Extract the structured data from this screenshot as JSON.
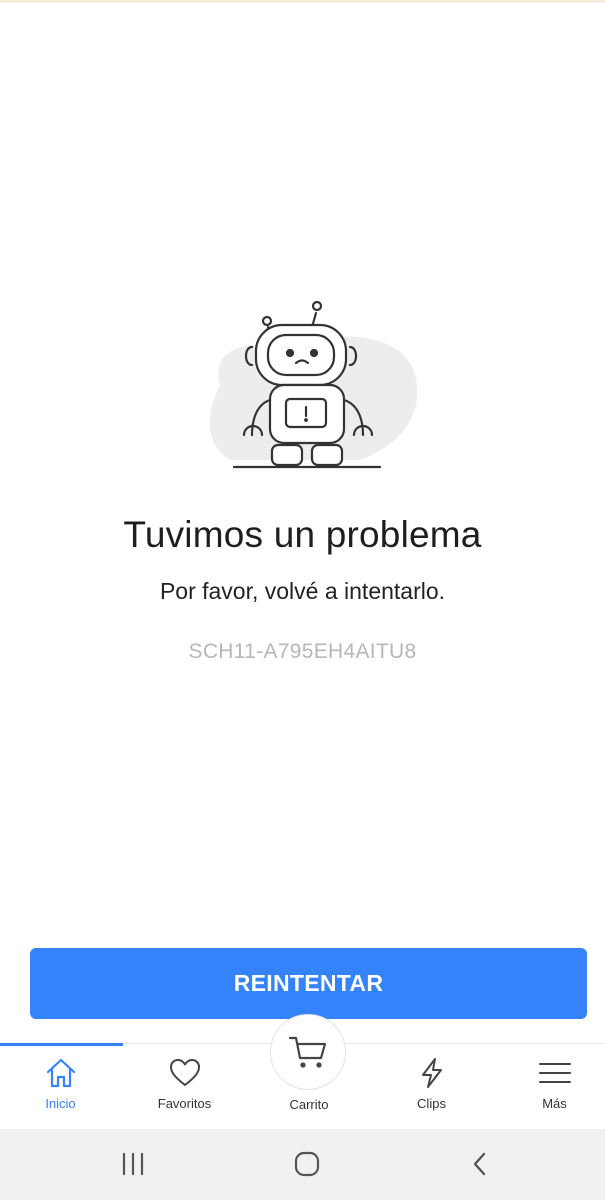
{
  "error": {
    "title": "Tuvimos un problema",
    "subtitle": "Por favor, volvé a intentarlo.",
    "code": "SCH11-A795EH4AITU8",
    "illustration_icon": "sad-robot-icon"
  },
  "actions": {
    "retry_label": "REINTENTAR"
  },
  "tabbar": {
    "tabs": [
      {
        "label": "Inicio",
        "icon": "home-icon",
        "active": true
      },
      {
        "label": "Favoritos",
        "icon": "heart-icon",
        "active": false
      },
      {
        "label": "Carrito",
        "icon": "cart-icon",
        "active": false
      },
      {
        "label": "Clips",
        "icon": "lightning-icon",
        "active": false
      },
      {
        "label": "Más",
        "icon": "menu-icon",
        "active": false
      }
    ]
  },
  "system_nav": {
    "buttons": [
      "recent-apps-icon",
      "home-circle-icon",
      "back-icon"
    ]
  },
  "colors": {
    "accent": "#3483fa",
    "code_text": "#b7b7b7",
    "nav_bg": "#f1f1f1"
  }
}
